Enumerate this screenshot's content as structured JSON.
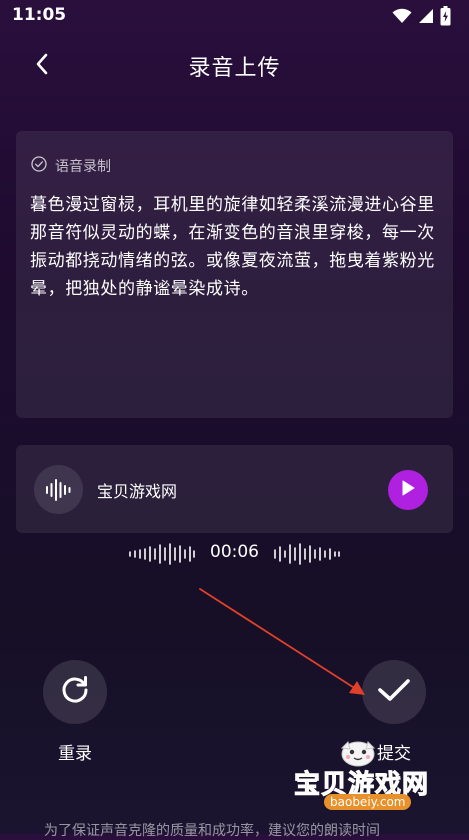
{
  "status_bar": {
    "time": "11:05",
    "icons": [
      "wifi-icon",
      "signal-icon",
      "battery-charging-icon"
    ]
  },
  "header": {
    "title": "录音上传",
    "back_icon": "chevron-left-icon"
  },
  "recording_card": {
    "label": "语音录制",
    "label_icon": "check-circle-icon",
    "text": "暮色漫过窗棂，耳机里的旋律如轻柔溪流漫进心谷里那音符似灵动的蝶，在渐变色的音浪里穿梭，每一次振动都挠动情绪的弦。或像夏夜流萤，拖曳着紫粉光晕，把独处的静谧晕染成诗。"
  },
  "audio_item": {
    "name": "宝贝游戏网",
    "icon": "sound-wave-icon",
    "play_icon": "play-icon"
  },
  "timer": {
    "value": "00:06"
  },
  "actions": {
    "redo_label": "重录",
    "submit_label": "提交",
    "redo_icon": "refresh-icon",
    "submit_icon": "check-icon"
  },
  "watermark": {
    "title": "宝贝游戏网",
    "domain": "baobeiy.com"
  },
  "footer": {
    "hint": "为了保证声音克隆的质量和成功率，建议您的朗读时间"
  },
  "colors": {
    "accent": "#b020e0",
    "arrow": "#e0402a",
    "background_top": "#2a0f3d",
    "background_bottom": "#1a1430"
  }
}
